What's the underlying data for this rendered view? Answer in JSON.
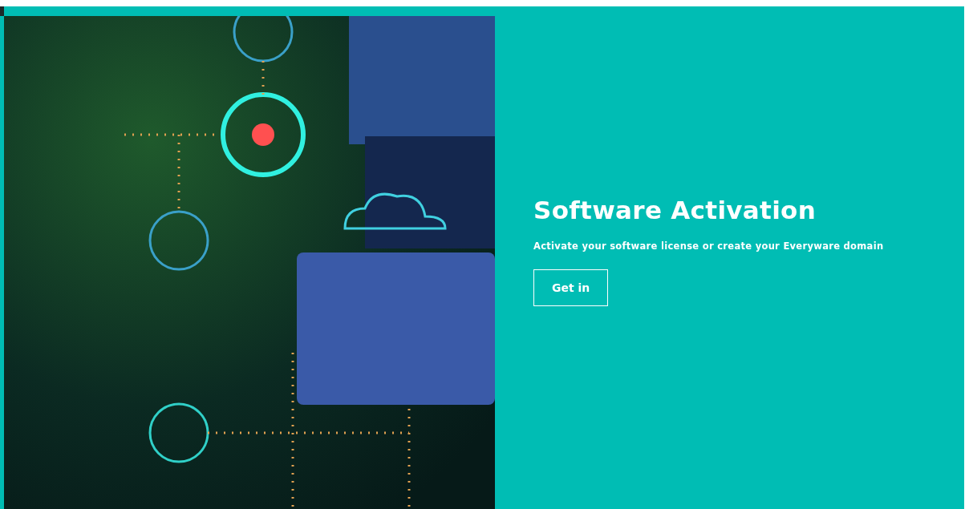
{
  "hero": {
    "title": "Software Activation",
    "subtitle": "Activate your software license or create your Everyware domain",
    "button": "Get in"
  }
}
